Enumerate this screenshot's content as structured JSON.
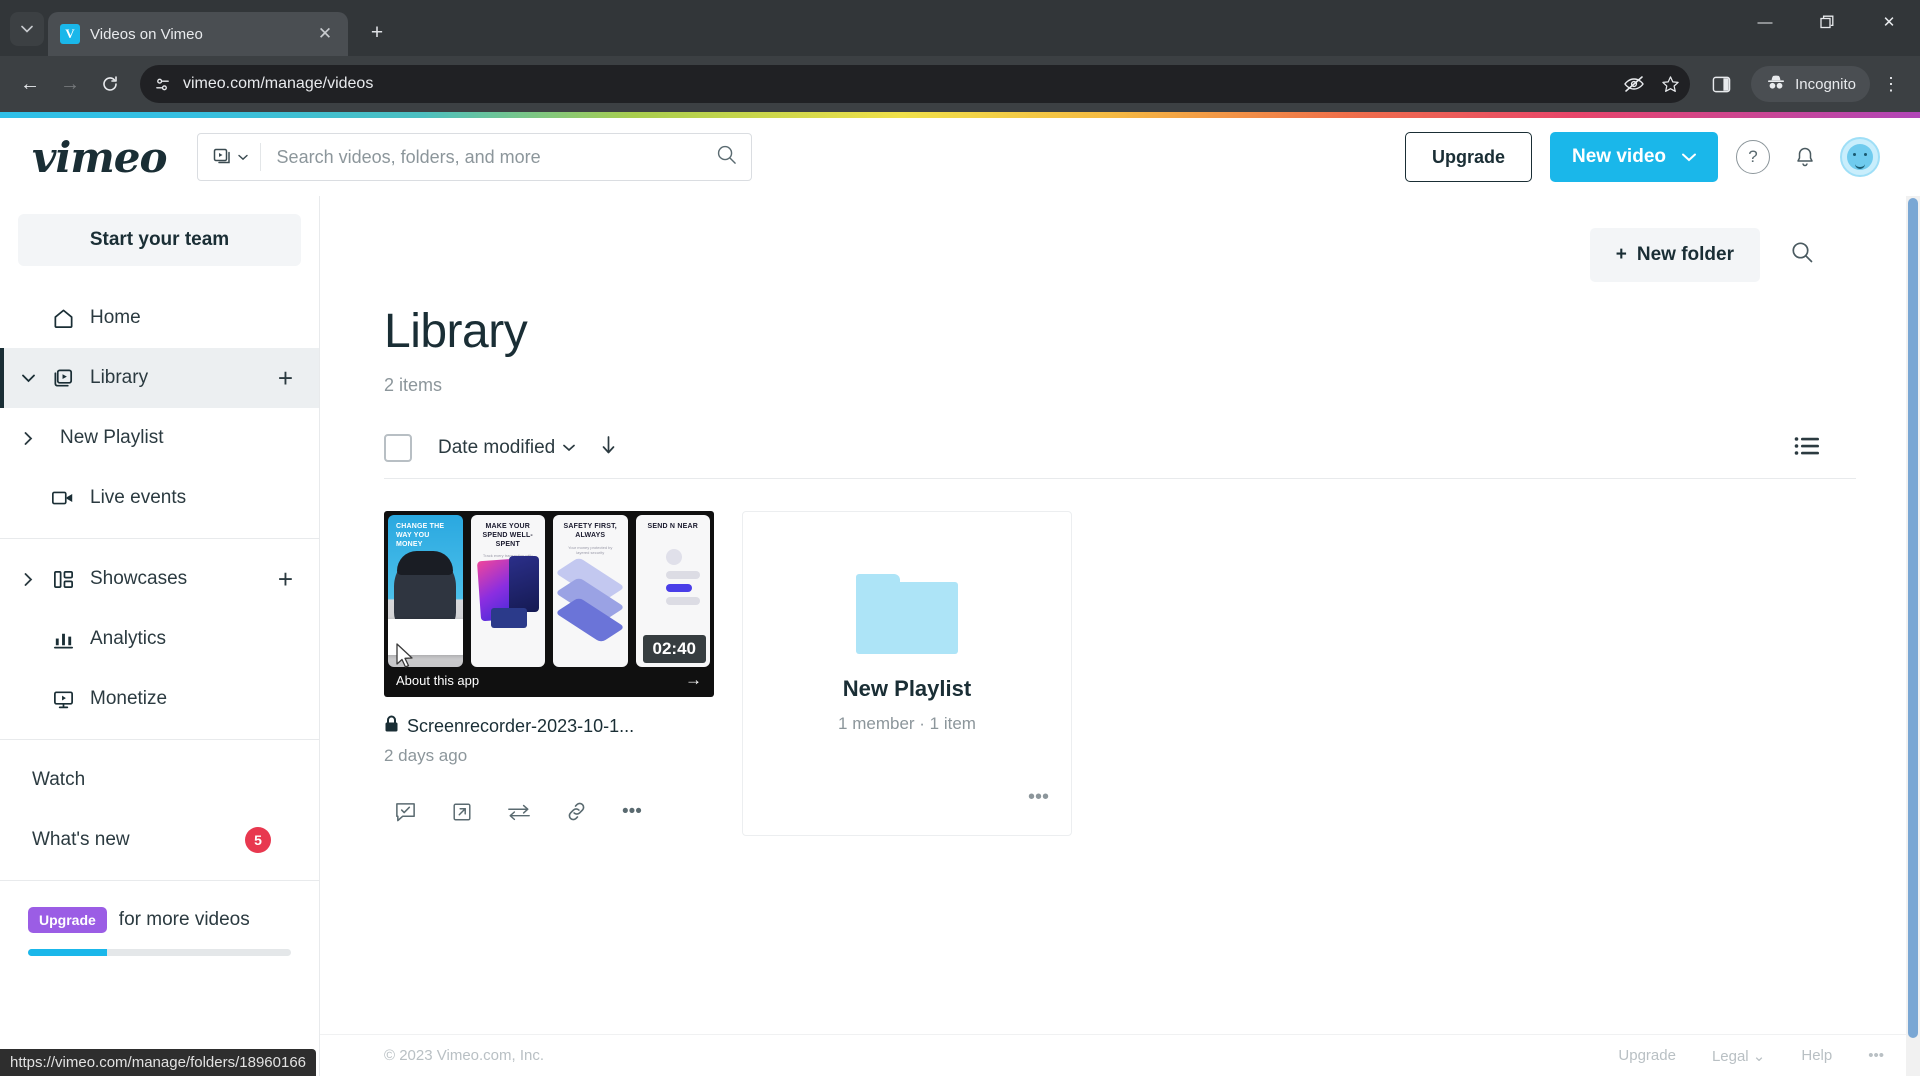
{
  "browser": {
    "tab": {
      "title": "Videos on Vimeo",
      "favicon_letter": "V"
    },
    "tab_list_icon": "chevron-down-icon",
    "new_tab_label": "+",
    "window_controls": {
      "minimize": "—",
      "maximize": "❐",
      "close": "✕"
    },
    "nav": {
      "back": "←",
      "forward": "→",
      "reload": "⟳"
    },
    "omnibox": {
      "url": "vimeo.com/manage/videos",
      "site_info_icon": "site-settings-icon"
    },
    "toolbar_right": {
      "tracking_icon": "eye-slash-icon",
      "bookmark_icon": "star-icon",
      "side_panel_icon": "side-panel-icon",
      "incognito_label": "Incognito",
      "menu_icon": "three-dot-menu-icon"
    },
    "status_url": "https://vimeo.com/manage/folders/18960166"
  },
  "header": {
    "logo": "vimeo",
    "search": {
      "placeholder": "Search videos, folders, and more",
      "value": "",
      "type_icon": "video-filter-icon",
      "search_icon": "search-icon"
    },
    "upgrade_label": "Upgrade",
    "new_video_label": "New video",
    "help_icon": "question-mark-icon",
    "notifications_icon": "bell-icon",
    "avatar": "user-avatar"
  },
  "sidebar": {
    "start_team_label": "Start your team",
    "items": [
      {
        "label": "Home",
        "icon": "home-icon",
        "chevron": "",
        "plus": false,
        "active": false
      },
      {
        "label": "Library",
        "icon": "library-icon",
        "chevron": "⌄",
        "plus": true,
        "active": true
      },
      {
        "label": "New Playlist",
        "icon": "",
        "chevron": "›",
        "plus": false,
        "active": false
      },
      {
        "label": "Live events",
        "icon": "live-camera-icon",
        "chevron": "",
        "plus": false,
        "active": false
      },
      {
        "label": "Showcases",
        "icon": "showcases-icon",
        "chevron": "›",
        "plus": true,
        "active": false
      },
      {
        "label": "Analytics",
        "icon": "bar-chart-icon",
        "chevron": "",
        "plus": false,
        "active": false
      },
      {
        "label": "Monetize",
        "icon": "monitor-play-icon",
        "chevron": "",
        "plus": false,
        "active": false
      }
    ],
    "watch_label": "Watch",
    "whats_new_label": "What's new",
    "whats_new_badge": "5",
    "upgrade_pill": "Upgrade",
    "upgrade_text": "for more videos",
    "storage_progress_pct": 30
  },
  "main": {
    "new_folder_label": "New folder",
    "new_folder_plus": "+",
    "search_icon": "search-icon",
    "title": "Library",
    "item_count": "2 items",
    "sort_label": "Date modified",
    "sort_chevron": "⌄",
    "sort_direction_icon": "arrow-down-icon",
    "view_toggle_icon": "list-view-icon",
    "select_all_checkbox": false,
    "video": {
      "title": "Screenrecorder-2023-10-1...",
      "meta": "2 days ago",
      "duration": "02:40",
      "privacy_icon": "lock-icon",
      "thumbnail_footer_label": "About this app",
      "thumbnail_panels": [
        {
          "headline": "CHANGE THE WAY YOU MONEY",
          "sub": ""
        },
        {
          "headline": "MAKE YOUR SPEND WELL-SPENT",
          "sub": "Track every transaction with clarity and control"
        },
        {
          "headline": "SAFETY FIRST, ALWAYS",
          "sub": "Your money protected by layered security"
        },
        {
          "headline": "SEND N NEAR",
          "sub": ""
        }
      ],
      "actions": [
        {
          "name": "review-icon",
          "glyph": "☑"
        },
        {
          "name": "open-external-icon",
          "glyph": "↗"
        },
        {
          "name": "replace-icon",
          "glyph": "⇌"
        },
        {
          "name": "copy-link-icon",
          "glyph": "🔗"
        },
        {
          "name": "more-options-icon",
          "glyph": "•••"
        }
      ]
    },
    "folder": {
      "name": "New Playlist",
      "meta": "1 member · 1 item",
      "icon": "folder-icon",
      "more_icon": "•••"
    }
  },
  "footer": {
    "copyright": "© 2023 Vimeo.com, Inc.",
    "links": [
      "Upgrade",
      "Legal ⌄",
      "Help",
      "•••"
    ]
  },
  "colors": {
    "vimeo_blue": "#1ab7ea",
    "badge_red": "#e8384f",
    "upgrade_purple": "#9b5de5",
    "folder_blue": "#ade4f7",
    "dark_text": "#1a2e35"
  }
}
